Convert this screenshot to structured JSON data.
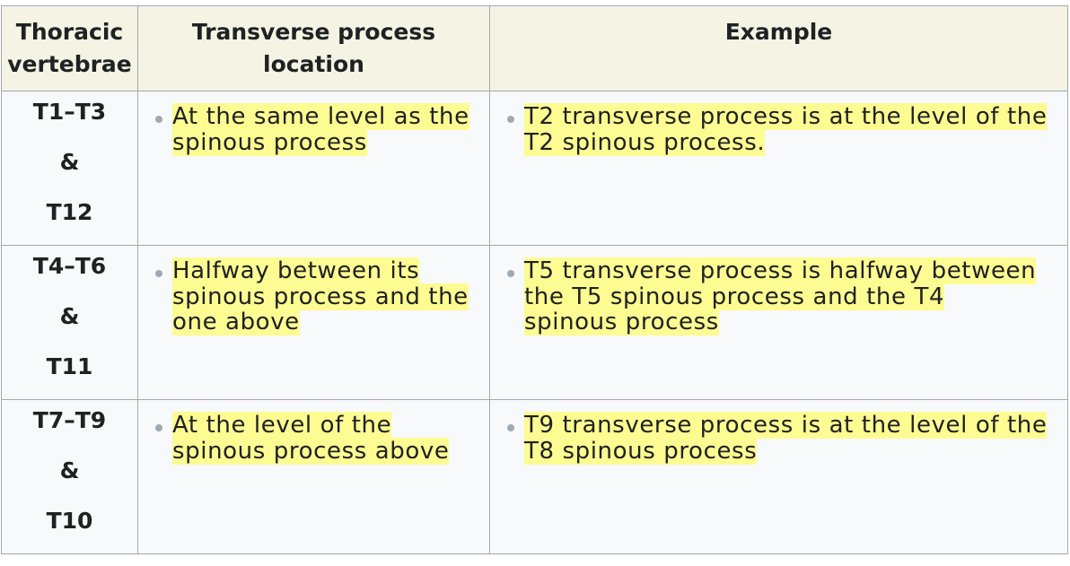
{
  "headers": [
    "Thoracic vertebrae",
    "Transverse process location",
    "Example"
  ],
  "header_lines": [
    [
      "Thoracic",
      "vertebrae"
    ],
    [
      "Transverse process",
      "location"
    ],
    [
      "Example"
    ]
  ],
  "rows": [
    {
      "vertebrae": [
        "T1–T3",
        "&",
        "T12"
      ],
      "location": [
        "At the same level as the",
        "spinous process"
      ],
      "example": [
        "T2 transverse process is at the level of the",
        "T2 spinous process."
      ]
    },
    {
      "vertebrae": [
        "T4–T6",
        "&",
        "T11"
      ],
      "location": [
        "Halfway between its",
        "spinous process and the",
        "one above"
      ],
      "example": [
        "T5 transverse process is halfway between",
        "the T5 spinous process and the T4",
        "spinous process"
      ]
    },
    {
      "vertebrae": [
        "T7–T9",
        "&",
        "T10"
      ],
      "location": [
        "At the level of the",
        "spinous process above"
      ],
      "example": [
        "T9 transverse process is at the level of the",
        "T8 spinous process"
      ]
    }
  ],
  "colors": {
    "header_bg": "#f4f3e4",
    "cell_bg": "#f8f9fa",
    "border": "#a2a9b1",
    "highlight": "#fdfc92",
    "bullet": "#a2a9b1"
  },
  "icons": {
    "bullet": "bullet-icon"
  }
}
